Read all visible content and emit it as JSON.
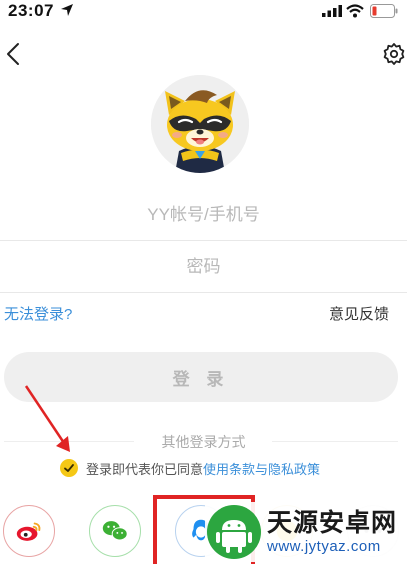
{
  "status_bar": {
    "time": "23:07"
  },
  "login": {
    "account_placeholder": "YY帐号/手机号",
    "password_placeholder": "密码",
    "cant_login_label": "无法登录?",
    "feedback_label": "意见反馈",
    "login_button_label": "登 录"
  },
  "other_login": {
    "title": "其他登录方式",
    "agreement_text": "登录即代表你已同意",
    "agreement_link": "使用条款与隐私政策",
    "methods": [
      "weibo-icon",
      "wechat-icon",
      "qq-icon",
      "yy-icon",
      "more-icon"
    ]
  },
  "watermark": {
    "title": "天源安卓网",
    "url": "www.jytyaz.com"
  },
  "colors": {
    "link_blue": "#3b8fd9",
    "check_yellow": "#f5c816",
    "button_gray": "#efefef",
    "annotation_red": "#e02424"
  }
}
